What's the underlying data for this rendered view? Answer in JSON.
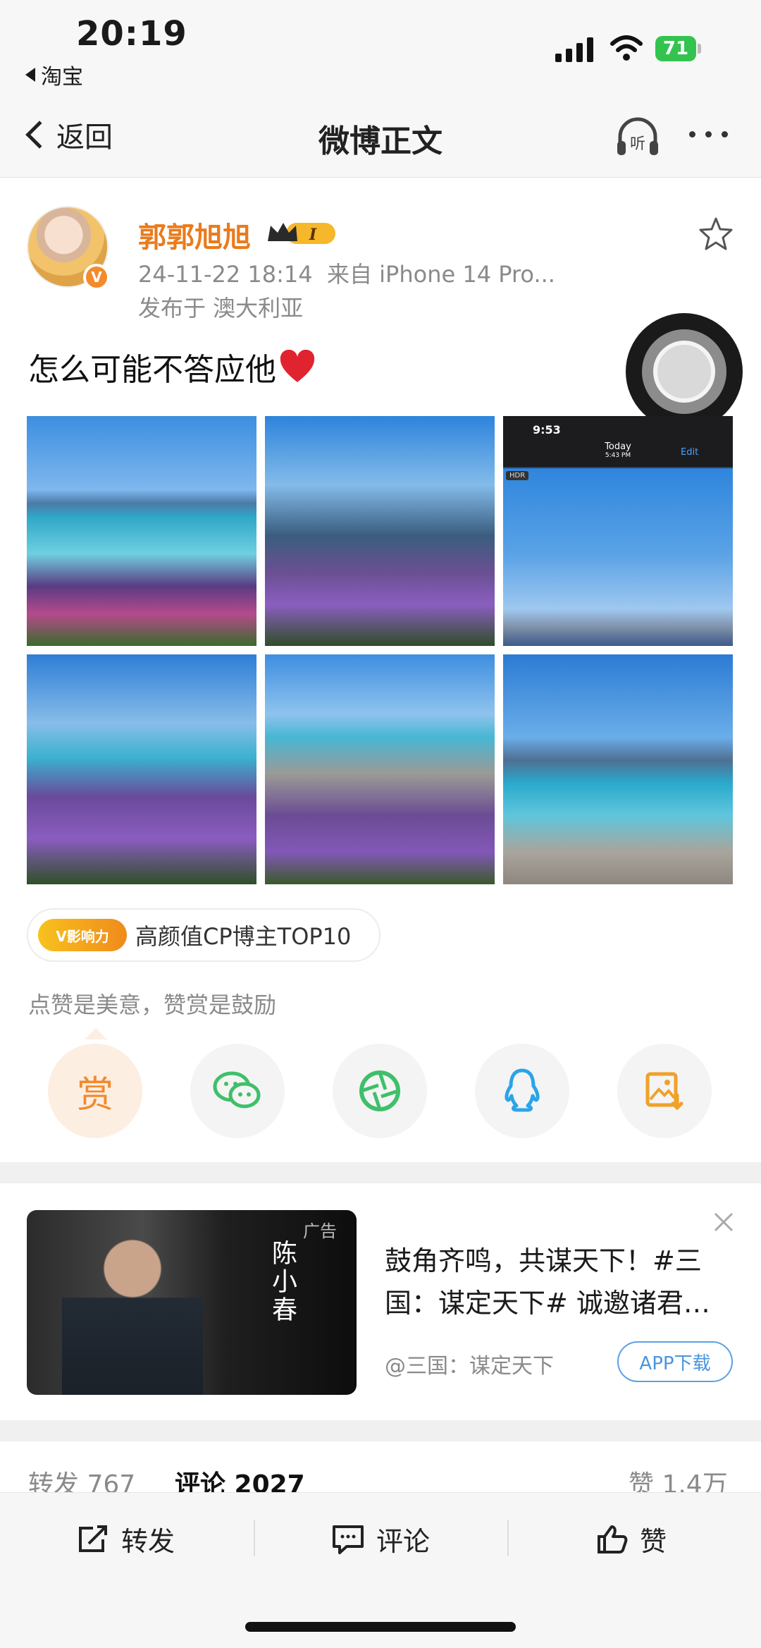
{
  "status_bar": {
    "time": "20:19",
    "back_app": "淘宝",
    "battery": "71"
  },
  "nav": {
    "back_label": "返回",
    "title": "微博正文",
    "listen_label": "听"
  },
  "post": {
    "username": "郭郭旭旭",
    "member_level": "I",
    "timestamp": "24-11-22 18:14",
    "source": "来自 iPhone 14 Pro...",
    "location": "发布于 澳大利亚",
    "text": "怎么可能不答应他",
    "verified": "V",
    "photo3": {
      "time": "9:53",
      "today": "Today",
      "today_time": "5:43 PM",
      "edit": "Edit",
      "hdr": "HDR"
    },
    "influence_logo": "V影响力",
    "influence_text": "高颜值CP博主TOP10",
    "reward_hint": "点赞是美意，赞赏是鼓励",
    "reward_label": "赏"
  },
  "ad": {
    "label": "广告",
    "person_name": "陈小春",
    "title": "鼓角齐鸣，共谋天下！#三国：谋定天下# 诚邀诸君…",
    "source": "@三国：谋定天下",
    "download": "APP下载"
  },
  "stats": {
    "forward": "转发 767",
    "comment": "评论 2027",
    "like": "赞 1.4万"
  },
  "bottom_bar": {
    "forward": "转发",
    "comment": "评论",
    "like": "赞"
  },
  "colors": {
    "accent_orange": "#ea7b1c",
    "link_blue": "#4a94de",
    "wechat_green": "#3fbf6a",
    "qq_blue": "#2aa4e8",
    "battery_green": "#33c44f"
  }
}
